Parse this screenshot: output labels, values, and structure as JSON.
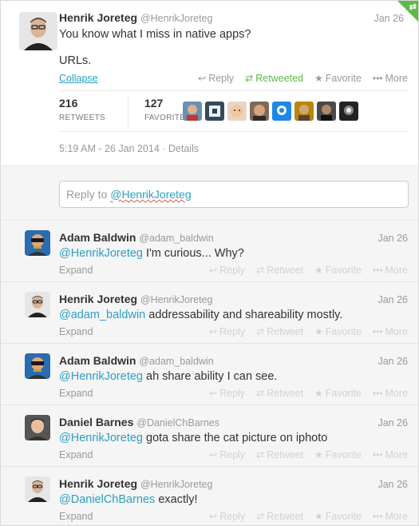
{
  "main_tweet": {
    "name": "Henrik Joreteg",
    "handle": "@HenrikJoreteg",
    "date": "Jan 26",
    "text_line1": "You know what I miss in native apps?",
    "text_line2": "URLs.",
    "collapse_label": "Collapse",
    "actions": {
      "reply": "Reply",
      "retweeted": "Retweeted",
      "favorite": "Favorite",
      "more": "More"
    },
    "stats": {
      "retweets_count": "216",
      "retweets_label": "RETWEETS",
      "favorites_count": "127",
      "favorites_label": "FAVORITES"
    },
    "timestamp": "5:19 AM - 26 Jan 2014",
    "details_label": "Details"
  },
  "reply_box": {
    "prefix": "Reply to ",
    "mention": "@HenrikJoreteg"
  },
  "replies": [
    {
      "name": "Adam Baldwin",
      "handle": "@adam_baldwin",
      "date": "Jan 26",
      "mention": "@HenrikJoreteg",
      "text": " I'm curious... Why?",
      "expand": "Expand"
    },
    {
      "name": "Henrik Joreteg",
      "handle": "@HenrikJoreteg",
      "date": "Jan 26",
      "mention": "@adam_baldwin",
      "text": " addressability and shareability mostly.",
      "expand": "Expand"
    },
    {
      "name": "Adam Baldwin",
      "handle": "@adam_baldwin",
      "date": "Jan 26",
      "mention": "@HenrikJoreteg",
      "text": " ah share ability I can see.",
      "expand": "Expand"
    },
    {
      "name": "Daniel Barnes",
      "handle": "@DanielChBarnes",
      "date": "Jan 26",
      "mention": "@HenrikJoreteg",
      "text": " gota share  the cat picture on iphoto",
      "expand": "Expand"
    },
    {
      "name": "Henrik Joreteg",
      "handle": "@HenrikJoreteg",
      "date": "Jan 26",
      "mention": "@DanielChBarnes",
      "text": " exactly!",
      "expand": "Expand"
    }
  ],
  "reply_actions": {
    "reply": "Reply",
    "retweet": "Retweet",
    "favorite": "Favorite",
    "more": "More"
  },
  "colors": {
    "link": "#2aa0c2",
    "retweeted": "#5cba47",
    "muted": "#999999",
    "reply_bg": "#f5f5f5"
  }
}
